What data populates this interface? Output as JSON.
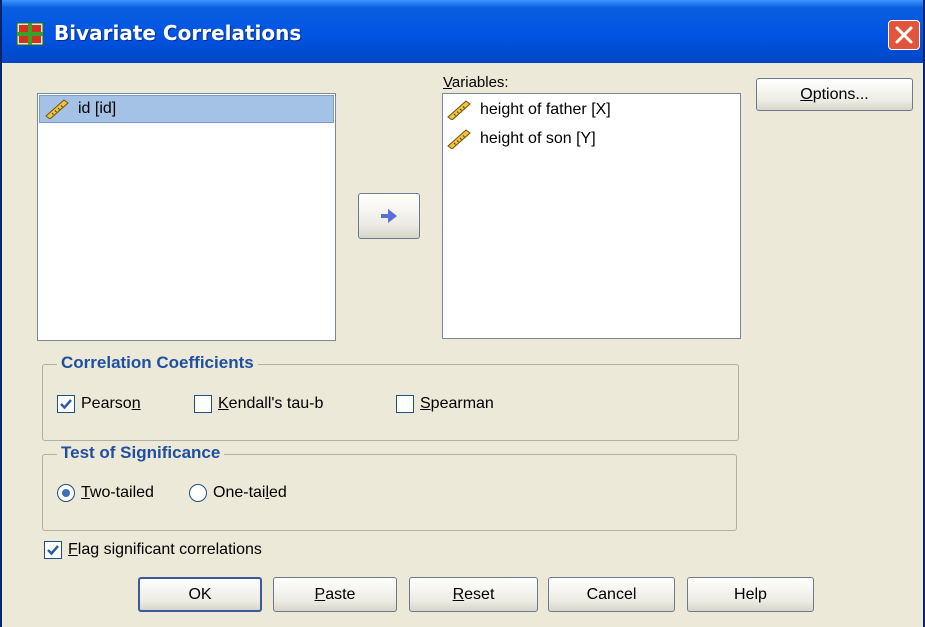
{
  "window": {
    "title": "Bivariate Correlations",
    "close_glyph": "✕"
  },
  "source_list": {
    "items": [
      {
        "label": "id [id]",
        "icon": "ruler-icon",
        "selected": true
      }
    ]
  },
  "variables": {
    "label_first": "V",
    "label_rest": "ariables:",
    "items": [
      {
        "label": "height of father [X]",
        "icon": "ruler-icon"
      },
      {
        "label": "height of son [Y]",
        "icon": "ruler-icon"
      }
    ]
  },
  "buttons": {
    "options": {
      "first": "O",
      "rest": "ptions..."
    },
    "ok": "OK",
    "paste": {
      "first": "P",
      "rest": "aste"
    },
    "reset": {
      "first": "R",
      "rest": "eset"
    },
    "cancel": "Cancel",
    "help": "Help"
  },
  "correlation_coefficients": {
    "title": "Correlation Coefficients",
    "pearson": {
      "pre": "Pearso",
      "ul": "n",
      "post": "",
      "checked": true
    },
    "kendall": {
      "pre": "",
      "ul": "K",
      "post": "endall's tau-b",
      "checked": false
    },
    "spearman": {
      "pre": "",
      "ul": "S",
      "post": "pearman",
      "checked": false
    }
  },
  "test_of_significance": {
    "title": "Test of Significance",
    "two_tailed": {
      "pre": "",
      "ul": "T",
      "post": "wo-tailed",
      "selected": true
    },
    "one_tailed": {
      "pre": "One-tai",
      "ul": "l",
      "post": "ed",
      "selected": false
    }
  },
  "flag": {
    "pre": "",
    "ul": "F",
    "post": "lag significant correlations",
    "checked": true
  },
  "colors": {
    "titlebar": "#0054e3",
    "close": "#e2553d",
    "group_title": "#1f4fa0",
    "selection": "#a4c2e6",
    "arrow": "#5a6fd0"
  }
}
